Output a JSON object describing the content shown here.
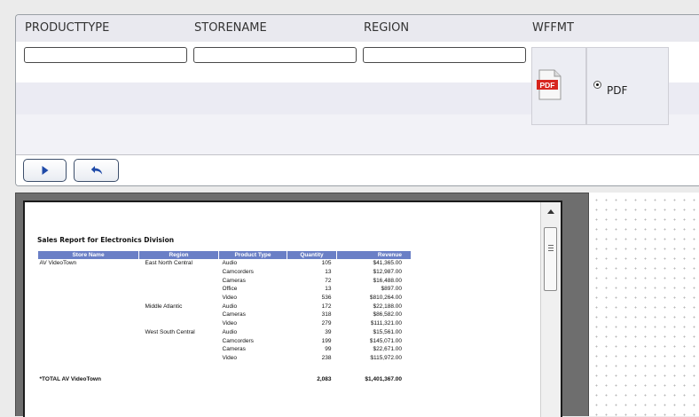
{
  "parameters": {
    "headers": [
      "PRODUCTTYPE",
      "STORENAME",
      "REGION",
      "WFFMT"
    ],
    "inputs": [
      {
        "name": "producttype",
        "value": ""
      },
      {
        "name": "storename",
        "value": ""
      },
      {
        "name": "region",
        "value": ""
      }
    ],
    "format": {
      "icon": "pdf-file-icon",
      "icon_text": "PDF",
      "option_label": "PDF",
      "selected": true
    }
  },
  "toolbar": {
    "run_icon": "play-triangle-icon",
    "reset_icon": "undo-arrow-icon"
  },
  "report": {
    "title": "Sales Report for Electronics Division",
    "columns": [
      "Store Name",
      "Region",
      "Product Type",
      "Quantity",
      "Revenue"
    ],
    "rows": [
      [
        "AV VideoTown",
        "East North Central",
        "Audio",
        "105",
        "$41,365.00"
      ],
      [
        "",
        "",
        "Camcorders",
        "13",
        "$12,987.00"
      ],
      [
        "",
        "",
        "Cameras",
        "72",
        "$16,488.00"
      ],
      [
        "",
        "",
        "Office",
        "13",
        "$897.00"
      ],
      [
        "",
        "",
        "Video",
        "536",
        "$810,264.00"
      ],
      [
        "",
        "Middle Atlantic",
        "Audio",
        "172",
        "$22,188.00"
      ],
      [
        "",
        "",
        "Cameras",
        "318",
        "$86,582.00"
      ],
      [
        "",
        "",
        "Video",
        "279",
        "$111,321.00"
      ],
      [
        "",
        "West South Central",
        "Audio",
        "39",
        "$15,561.00"
      ],
      [
        "",
        "",
        "Camcorders",
        "199",
        "$145,071.00"
      ],
      [
        "",
        "",
        "Cameras",
        "99",
        "$22,671.00"
      ],
      [
        "",
        "",
        "Video",
        "238",
        "$115,972.00"
      ]
    ],
    "total": [
      "*TOTAL AV VideoTown",
      "",
      "",
      "2,083",
      "$1,401,367.00"
    ]
  },
  "colors": {
    "table_header_bg": "#6a7fc6",
    "button_icon": "#1f4aa8",
    "pdf_red": "#d7261e"
  }
}
